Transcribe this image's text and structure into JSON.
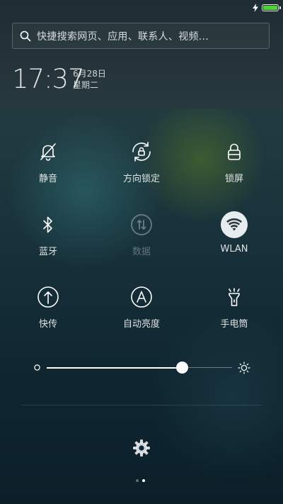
{
  "status_bar": {
    "battery_level": 1.0,
    "battery_color": "#53d236",
    "charging_icon": "lightning-bolt-icon"
  },
  "search": {
    "placeholder": "快捷搜索网页、应用、联系人、视频..."
  },
  "clock": {
    "time": "17:37",
    "date": "6月28日",
    "weekday": "星期二"
  },
  "toggles": [
    {
      "label": "静音",
      "icon": "bell-off-icon",
      "state": "off"
    },
    {
      "label": "方向锁定",
      "icon": "rotation-lock-icon",
      "state": "off"
    },
    {
      "label": "锁屏",
      "icon": "lock-icon",
      "state": "off"
    },
    {
      "label": "蓝牙",
      "icon": "bluetooth-icon",
      "state": "off"
    },
    {
      "label": "数据",
      "icon": "mobile-data-icon",
      "state": "disabled"
    },
    {
      "label": "WLAN",
      "icon": "wifi-icon",
      "state": "on"
    },
    {
      "label": "快传",
      "icon": "upload-arrow-icon",
      "state": "off"
    },
    {
      "label": "自动亮度",
      "icon": "auto-brightness-icon",
      "state": "off"
    },
    {
      "label": "手电筒",
      "icon": "flashlight-icon",
      "state": "off"
    }
  ],
  "brightness": {
    "level": 0.73
  },
  "settings": {
    "icon": "gear-icon"
  },
  "pager": {
    "pages": 2,
    "active_page": 2
  },
  "colors": {
    "accent_active_bg": "#e7ecee",
    "background_top": "#23393f",
    "background_bottom": "#0b1f29"
  }
}
